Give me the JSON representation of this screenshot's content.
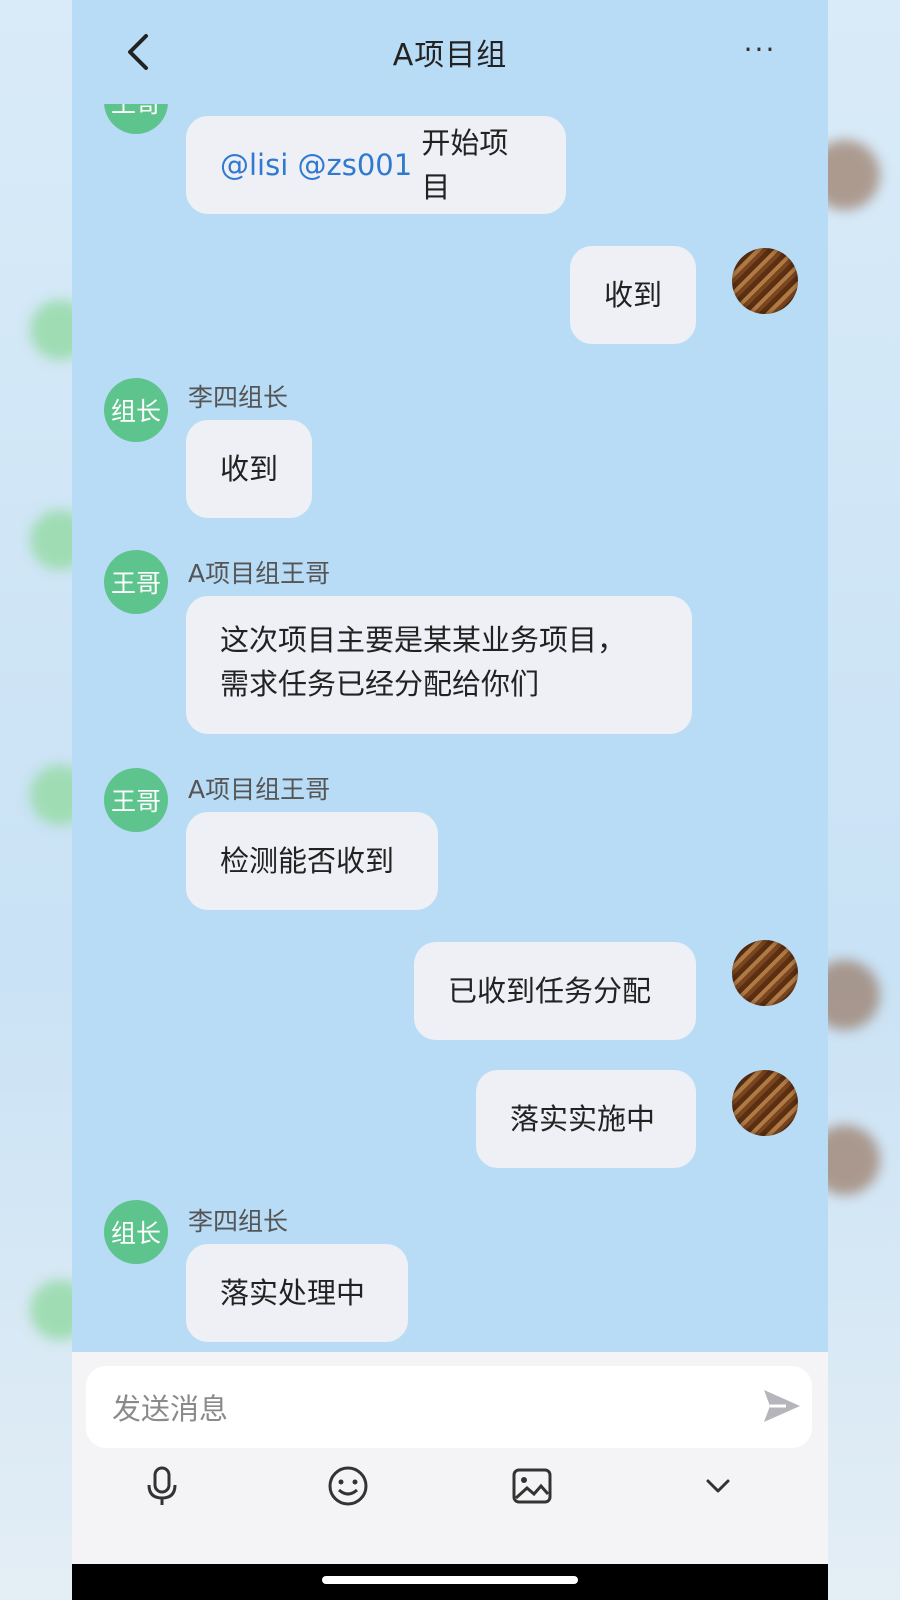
{
  "header": {
    "title": "A项目组",
    "more_label": "···"
  },
  "messages": [
    {
      "side": "left",
      "avatar_text": "王哥",
      "sender": "",
      "text_mentions": [
        "@lisi",
        "@zs001"
      ],
      "text": "开始项目"
    },
    {
      "side": "right",
      "text": "收到"
    },
    {
      "side": "left",
      "avatar_text": "组长",
      "sender": "李四组长",
      "text": "收到"
    },
    {
      "side": "left",
      "avatar_text": "王哥",
      "sender": "A项目组王哥",
      "lines": [
        "这次项目主要是某某业务项目，",
        "需求任务已经分配给你们"
      ]
    },
    {
      "side": "left",
      "avatar_text": "王哥",
      "sender": "A项目组王哥",
      "text": "检测能否收到"
    },
    {
      "side": "right",
      "text": "已收到任务分配"
    },
    {
      "side": "right",
      "text": "落实实施中"
    },
    {
      "side": "left",
      "avatar_text": "组长",
      "sender": "李四组长",
      "text": "落实处理中"
    }
  ],
  "input": {
    "placeholder": "发送消息"
  },
  "colors": {
    "chat_background": "#b9dcf6",
    "bubble": "#eef0f6",
    "avatar_green": "#5cc48c",
    "mention_blue": "#2f7ad0"
  },
  "icons": [
    "back-arrow-icon",
    "more-icon",
    "send-icon",
    "microphone-icon",
    "emoji-icon",
    "image-icon",
    "chevron-down-icon"
  ]
}
